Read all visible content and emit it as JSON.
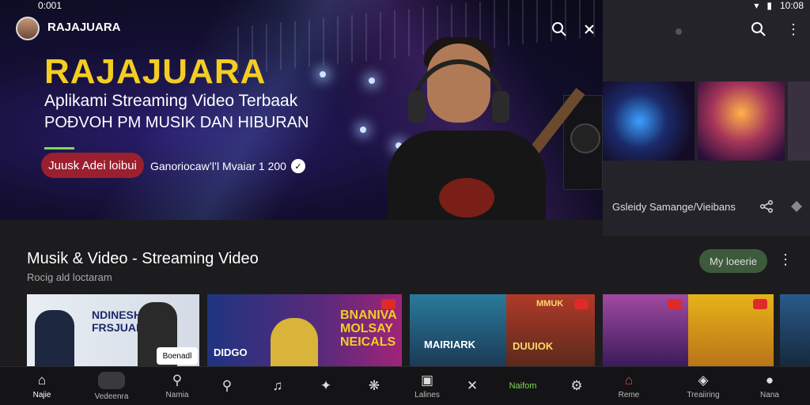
{
  "status": {
    "time": "0:001",
    "right_time": "10:08"
  },
  "header": {
    "brand": "RAJAJUARA",
    "search_icon": "search-icon",
    "cast_icon": "cast-icon"
  },
  "hero": {
    "title": "RAJAJUARA",
    "subtitle_line1": "Aplikami Streaming Video Terbaak",
    "subtitle_line2": "POÐVOH PM MUSIK DAN HIBURAN",
    "cta_label": "Juusk Adei loibui",
    "meta_text": "Ganoriocaw’l’l Mvaiar 1 200",
    "accent_color": "#f3cd22"
  },
  "right_panel": {
    "caption": "Gsleidy Samange/Vieibans"
  },
  "section": {
    "title": "Musik & Video - Streaming Video",
    "subtitle": "Rocig ald loctaram",
    "button_label": "My loeerie"
  },
  "cards": [
    {
      "title": "NDINESHA\nFRSJUAIN",
      "tag": "Boenadl"
    },
    {
      "title": "BNANIVA\nMOLSAY\nNEICALS",
      "left_text": "DIDGO"
    },
    {
      "title": "MAIRIARK"
    },
    {
      "title": "DUUIOK",
      "top_text": "MMUK"
    }
  ],
  "bottom_nav": [
    {
      "label": "Najie",
      "icon": "home-icon"
    },
    {
      "label": "Vedeenra",
      "icon": "video-pill-icon"
    },
    {
      "label": "Namia",
      "icon": "search-icon"
    },
    {
      "label": "",
      "icon": "search-icon"
    },
    {
      "label": "",
      "icon": "music-icon"
    },
    {
      "label": "",
      "icon": "compass-icon"
    },
    {
      "label": "",
      "icon": "share-icon"
    },
    {
      "label": "Lalines",
      "icon": "library-icon"
    },
    {
      "label": "",
      "icon": "tools-icon"
    },
    {
      "label": "Naifom",
      "icon": "brand-icon"
    },
    {
      "label": "",
      "icon": "settings-icon"
    },
    {
      "label": "Reme",
      "icon": "home-icon"
    },
    {
      "label": "Treaiiring",
      "icon": "trending-icon"
    },
    {
      "label": "Nana",
      "icon": "profile-icon"
    }
  ]
}
